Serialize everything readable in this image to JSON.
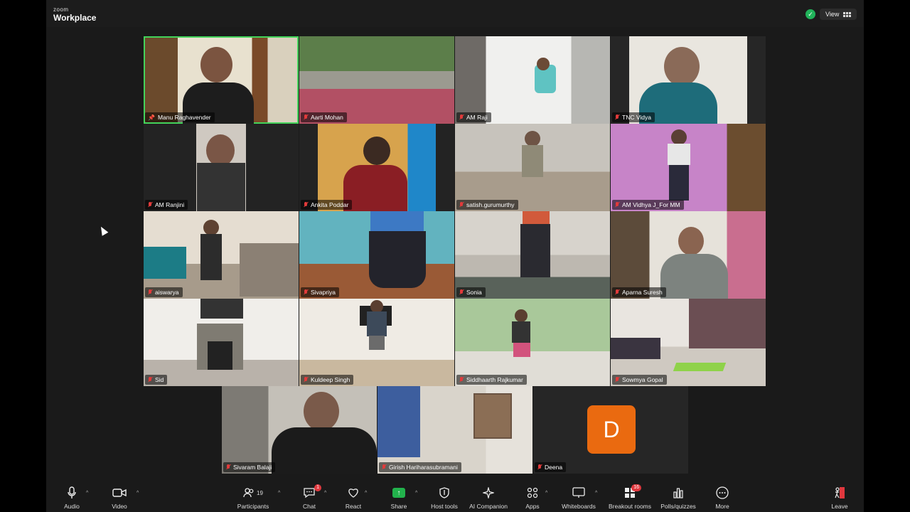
{
  "brand": {
    "line1": "zoom",
    "line2": "Workplace"
  },
  "view_button": {
    "label": "View"
  },
  "participants": [
    {
      "name": "Manu Raghavender",
      "active": true,
      "pinned": true
    },
    {
      "name": "Aarti Mohan"
    },
    {
      "name": "AM Raji"
    },
    {
      "name": "TNC Vidya"
    },
    {
      "name": "AM Ranjini"
    },
    {
      "name": "Ankita Poddar"
    },
    {
      "name": "satish.gurumurthy"
    },
    {
      "name": "AM Vidhya J_For MM"
    },
    {
      "name": "aiswarya"
    },
    {
      "name": "Sivapriya"
    },
    {
      "name": "Sonia"
    },
    {
      "name": "Aparna Suresh"
    },
    {
      "name": "Sid"
    },
    {
      "name": "Kuldeep Singh"
    },
    {
      "name": "Siddhaarth Rajkumar"
    },
    {
      "name": "Sowmya Gopal"
    },
    {
      "name": "Sivaram Balaji"
    },
    {
      "name": "Girish Hariharasubramani"
    },
    {
      "name": "Deena",
      "avatar_letter": "D"
    }
  ],
  "toolbar": {
    "audio": "Audio",
    "video": "Video",
    "participants": "Participants",
    "participants_count": "19",
    "chat": "Chat",
    "chat_badge": "1",
    "react": "React",
    "share": "Share",
    "host_tools": "Host tools",
    "ai_companion": "AI Companion",
    "apps": "Apps",
    "whiteboards": "Whiteboards",
    "breakout_rooms": "Breakout rooms",
    "breakout_badge": "16",
    "polls": "Polls/quizzes",
    "more": "More",
    "leave": "Leave"
  }
}
